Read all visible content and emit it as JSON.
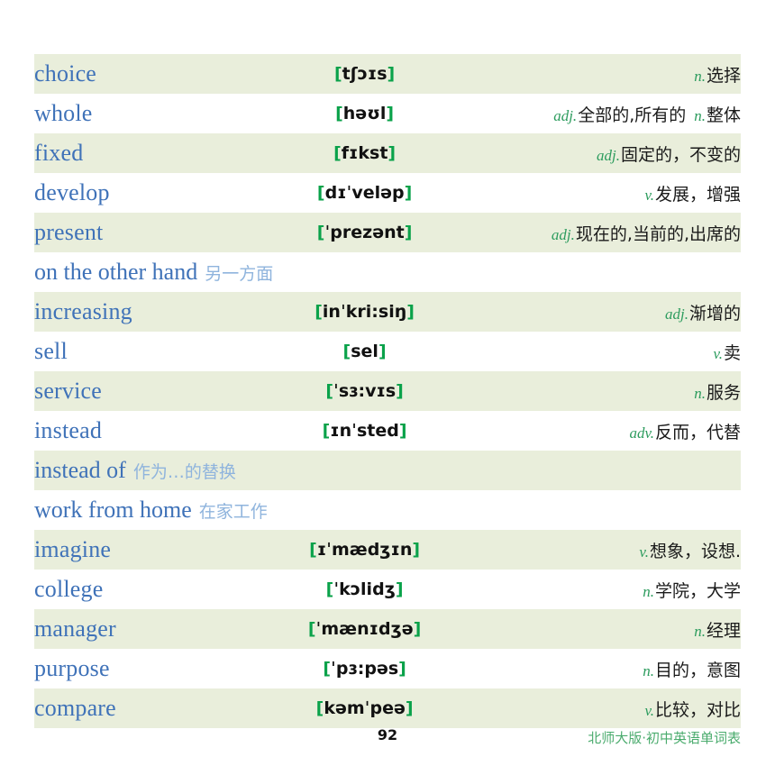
{
  "page": {
    "number": "92",
    "footer_label": "北师大版·初中英语单词表"
  },
  "colors": {
    "word_blue": "#3f72b8",
    "phrase_cn_blue": "#8fb4dd",
    "pos_green": "#2d9c5e",
    "bracket_green": "#0aa24a",
    "row_shade": "#e9eedb",
    "row_plain": "#ffffff",
    "footer_green": "#4aab6d"
  },
  "entries": [
    {
      "type": "word",
      "shaded": true,
      "word": "choice",
      "ipa_open": "[",
      "ipa": "tʃɔɪs",
      "ipa_close": "]",
      "defs": [
        {
          "pos": "n.",
          "meaning": "选择"
        }
      ]
    },
    {
      "type": "word",
      "shaded": false,
      "word": "whole",
      "ipa_open": "[",
      "ipa": "həʊl",
      "ipa_close": "]",
      "defs": [
        {
          "pos": "adj.",
          "meaning": "全部的,所有的"
        },
        {
          "pos": "n.",
          "meaning": "整体"
        }
      ]
    },
    {
      "type": "word",
      "shaded": true,
      "word": "fixed",
      "ipa_open": "[",
      "ipa": "fɪkst",
      "ipa_close": "]",
      "defs": [
        {
          "pos": "adj.",
          "meaning": "固定的，不变的"
        }
      ]
    },
    {
      "type": "word",
      "shaded": false,
      "word": "develop",
      "ipa_open": "[",
      "ipa": "dɪˈveləp",
      "ipa_close": "]",
      "defs": [
        {
          "pos": "v.",
          "meaning": "发展，增强"
        }
      ]
    },
    {
      "type": "word",
      "shaded": true,
      "word": "present",
      "ipa_open": "[",
      "ipa": "ˈprezənt",
      "ipa_close": "]",
      "defs": [
        {
          "pos": "adj.",
          "meaning": "现在的,当前的,出席的"
        }
      ]
    },
    {
      "type": "phrase",
      "shaded": false,
      "english": "on the other hand",
      "chinese": "另一方面"
    },
    {
      "type": "word",
      "shaded": true,
      "word": "increasing",
      "ipa_open": "[",
      "ipa": "inˈkri:siŋ",
      "ipa_close": "]",
      "defs": [
        {
          "pos": "adj.",
          "meaning": "渐增的"
        }
      ]
    },
    {
      "type": "word",
      "shaded": false,
      "word": "sell",
      "ipa_open": "[",
      "ipa": "sel",
      "ipa_close": "]",
      "defs": [
        {
          "pos": "v.",
          "meaning": "卖"
        }
      ]
    },
    {
      "type": "word",
      "shaded": true,
      "word": "service",
      "ipa_open": "[",
      "ipa": "ˈsɜ:vɪs",
      "ipa_close": "]",
      "defs": [
        {
          "pos": "n.",
          "meaning": "服务"
        }
      ]
    },
    {
      "type": "word",
      "shaded": false,
      "word": "instead",
      "ipa_open": "[",
      "ipa": "ɪnˈsted",
      "ipa_close": "]",
      "defs": [
        {
          "pos": "adv.",
          "meaning": "反而，代替"
        }
      ]
    },
    {
      "type": "phrase",
      "shaded": true,
      "english": "instead of",
      "chinese": "作为…的替换"
    },
    {
      "type": "phrase",
      "shaded": false,
      "english": "work from home",
      "chinese": "在家工作"
    },
    {
      "type": "word",
      "shaded": true,
      "word": "imagine",
      "ipa_open": "[",
      "ipa": "ɪˈmædʒɪn",
      "ipa_close": "]",
      "defs": [
        {
          "pos": "v.",
          "meaning": "想象，设想."
        }
      ]
    },
    {
      "type": "word",
      "shaded": false,
      "word": "college",
      "ipa_open": "[",
      "ipa": "ˈkɔlidʒ",
      "ipa_close": "]",
      "defs": [
        {
          "pos": "n.",
          "meaning": "学院，大学"
        }
      ]
    },
    {
      "type": "word",
      "shaded": true,
      "word": "manager",
      "ipa_open": "[",
      "ipa": "ˈmænɪdʒə",
      "ipa_close": "]",
      "defs": [
        {
          "pos": "n.",
          "meaning": "经理"
        }
      ]
    },
    {
      "type": "word",
      "shaded": false,
      "word": "purpose",
      "ipa_open": "[",
      "ipa": "ˈpɜ:pəs",
      "ipa_close": "]",
      "defs": [
        {
          "pos": "n.",
          "meaning": "目的，意图"
        }
      ]
    },
    {
      "type": "word",
      "shaded": true,
      "word": "compare",
      "ipa_open": "[",
      "ipa": "kəmˈpeə",
      "ipa_close": "]",
      "defs": [
        {
          "pos": "v.",
          "meaning": "比较，对比"
        }
      ]
    }
  ]
}
